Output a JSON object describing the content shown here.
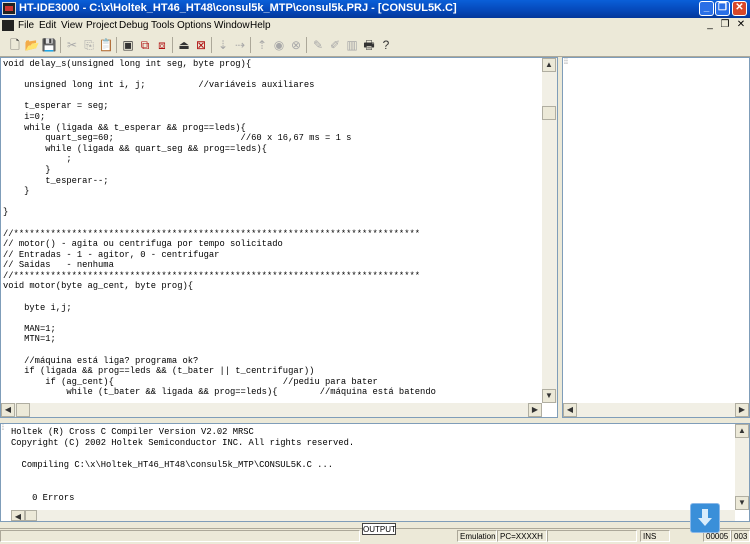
{
  "window": {
    "title": "HT-IDE3000  -  C:\\x\\Holtek_HT46_HT48\\consul5k_MTP\\consul5k.PRJ - [CONSUL5K.C]"
  },
  "menu": {
    "items": [
      "File",
      "Edit",
      "View",
      "Project",
      "Debug",
      "Tools",
      "Options",
      "Window",
      "Help"
    ]
  },
  "toolbar": {
    "buttons": [
      "new-file-icon",
      "open-folder-icon",
      "save-icon",
      "cut-icon",
      "copy-icon",
      "paste-icon",
      "build-icon",
      "rebuild-icon",
      "stop-build-icon",
      "reset-icon",
      "power-on-icon",
      "step-into-icon",
      "step-over-icon",
      "step-out-icon",
      "breakpoint-icon",
      "clear-breakpoint-icon",
      "watch-icon",
      "disasm-icon",
      "memory-icon",
      "print-icon",
      "help-icon"
    ]
  },
  "editor": {
    "lines": [
      "void delay_s(unsigned long int seg, byte prog){",
      "",
      "    unsigned long int i, j;          //variáveis auxiliares",
      "",
      "    t_esperar = seg;",
      "    i=0;",
      "    while (ligada && t_esperar && prog==leds){",
      "        quart_seg=60;                        //60 x 16,67 ms = 1 s",
      "        while (ligada && quart_seg && prog==leds){",
      "            ;",
      "        }",
      "        t_esperar--;",
      "    }",
      "",
      "}",
      "",
      "//*****************************************************************************",
      "// motor() - agita ou centrifuga por tempo solicitado",
      "// Entradas - 1 - agitor, 0 - centrifugar",
      "// Saidas   - nenhuma",
      "//*****************************************************************************",
      "void motor(byte ag_cent, byte prog){",
      "",
      "    byte i,j;",
      "",
      "    MAN=1;",
      "    MTN=1;",
      "",
      "    //máquina está liga? programa ok?",
      "    if (ligada && prog==leds && (t_bater || t_centrifugar))",
      "        if (ag_cent){                                //pediu para bater",
      "            while (t_bater && ligada && prog==leds){        //máquina está batendo"
    ]
  },
  "output": {
    "lines": [
      "Holtek (R) Cross C Compiler Version V2.02 MRSC",
      "Copyright (C) 2002 Holtek Semiconductor INC. All rights reserved.",
      "  Compiling C:\\x\\Holtek_HT46_HT48\\consul5k_MTP\\CONSUL5K.C ...",
      "    0 Errors"
    ],
    "tab_label": "OUTPUT"
  },
  "status": {
    "mode": "Emulation",
    "pc": "PC=XXXXH",
    "ins": "INS",
    "line": "00005",
    "col": "003"
  }
}
